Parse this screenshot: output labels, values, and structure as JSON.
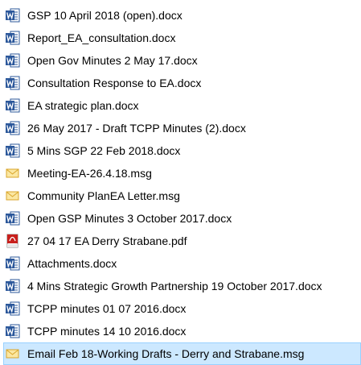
{
  "files": [
    {
      "name": "GSP 10 April 2018 (open).docx",
      "type": "docx",
      "selected": false
    },
    {
      "name": "Report_EA_consultation.docx",
      "type": "docx",
      "selected": false
    },
    {
      "name": "Open Gov Minutes 2 May 17.docx",
      "type": "docx",
      "selected": false
    },
    {
      "name": "Consultation Response to EA.docx",
      "type": "docx",
      "selected": false
    },
    {
      "name": "EA strategic plan.docx",
      "type": "docx",
      "selected": false
    },
    {
      "name": "26 May 2017 - Draft TCPP Minutes (2).docx",
      "type": "docx",
      "selected": false
    },
    {
      "name": "5  Mins SGP 22 Feb 2018.docx",
      "type": "docx",
      "selected": false
    },
    {
      "name": "Meeting-EA-26.4.18.msg",
      "type": "msg",
      "selected": false
    },
    {
      "name": "Community PlanEA Letter.msg",
      "type": "msg",
      "selected": false
    },
    {
      "name": "Open GSP Minutes 3 October 2017.docx",
      "type": "docx",
      "selected": false
    },
    {
      "name": "27 04 17 EA Derry  Strabane.pdf",
      "type": "pdf",
      "selected": false
    },
    {
      "name": "Attachments.docx",
      "type": "docx",
      "selected": false
    },
    {
      "name": "4  Mins Strategic Growth Partnership  19 October 2017.docx",
      "type": "docx",
      "selected": false
    },
    {
      "name": "TCPP minutes  01 07 2016.docx",
      "type": "docx",
      "selected": false
    },
    {
      "name": "TCPP minutes  14 10 2016.docx",
      "type": "docx",
      "selected": false
    },
    {
      "name": "Email Feb 18-Working Drafts - Derry and Strabane.msg",
      "type": "msg",
      "selected": true
    }
  ],
  "icons": {
    "docx": "word-document-icon",
    "msg": "outlook-message-icon",
    "pdf": "pdf-document-icon"
  },
  "colors": {
    "word_blue": "#2b579a",
    "word_light": "#e8eef8",
    "envelope": "#f3c64b",
    "pdf_red": "#c8201c",
    "selection_bg": "#cce8ff",
    "selection_border": "#99d1ff"
  }
}
